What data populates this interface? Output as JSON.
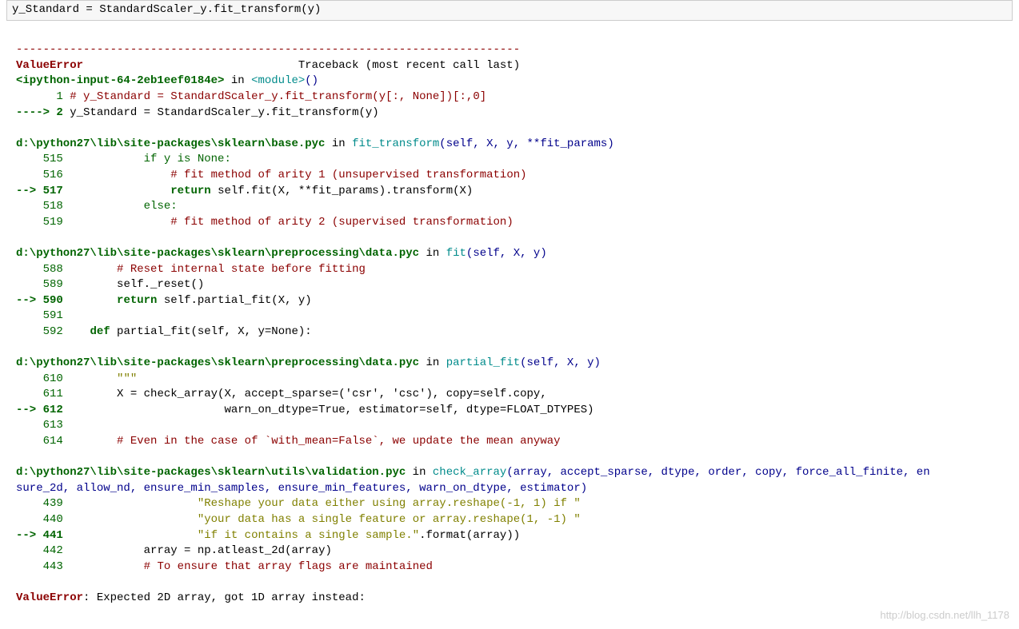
{
  "input_cell": "y_Standard = StandardScaler_y.fit_transform(y)",
  "dashes": "---------------------------------------------------------------------------",
  "header": {
    "error_name": "ValueError",
    "traceback_label": "Traceback (most recent call last)"
  },
  "frame_input": {
    "location": "<ipython-input-64-2eb1eef0184e>",
    "in": " in ",
    "module": "<module>",
    "parens": "()",
    "line1": {
      "num": "1",
      "text": "# y_Standard = StandardScaler_y.fit_transform(y[:, None])[:,0]"
    },
    "line2": {
      "arrow": "----> ",
      "num": "2",
      "text": " y_Standard = StandardScaler_y.fit_transform(y)"
    }
  },
  "frame_base": {
    "path": "d:\\python27\\lib\\site-packages\\sklearn\\base.pyc",
    "in": " in ",
    "func": "fit_transform",
    "sig": "(self, X, y, **fit_params)",
    "l515": {
      "num": "515",
      "code": "            if y is None:"
    },
    "l516": {
      "num": "516",
      "code": "                # fit method of arity 1 (unsupervised transformation)"
    },
    "l517": {
      "arrow": "--> ",
      "num": "517",
      "code_pre": "                ",
      "kw": "return",
      "code_post": " self.fit(X, **fit_params).transform(X)"
    },
    "l518": {
      "num": "518",
      "code": "            else:"
    },
    "l519": {
      "num": "519",
      "code": "                # fit method of arity 2 (supervised transformation)"
    }
  },
  "frame_data_fit": {
    "path": "d:\\python27\\lib\\site-packages\\sklearn\\preprocessing\\data.pyc",
    "in": " in ",
    "func": "fit",
    "sig": "(self, X, y)",
    "l588": {
      "num": "588",
      "code": "        # Reset internal state before fitting"
    },
    "l589": {
      "num": "589",
      "code": "        self._reset()"
    },
    "l590": {
      "arrow": "--> ",
      "num": "590",
      "code_pre": "        ",
      "kw": "return",
      "code_post": " self.partial_fit(X, y)"
    },
    "l591": {
      "num": "591",
      "code": ""
    },
    "l592": {
      "num": "592",
      "code_pre": "    ",
      "kw": "def",
      "code_post": " partial_fit(self, X, y=None):"
    }
  },
  "frame_data_pfit": {
    "path": "d:\\python27\\lib\\site-packages\\sklearn\\preprocessing\\data.pyc",
    "in": " in ",
    "func": "partial_fit",
    "sig": "(self, X, y)",
    "l610": {
      "num": "610",
      "code": "        \"\"\""
    },
    "l611": {
      "num": "611",
      "code": "        X = check_array(X, accept_sparse=('csr', 'csc'), copy=self.copy,"
    },
    "l612": {
      "arrow": "--> ",
      "num": "612",
      "code": "                        warn_on_dtype=True, estimator=self, dtype=FLOAT_DTYPES)"
    },
    "l613": {
      "num": "613",
      "code": ""
    },
    "l614": {
      "num": "614",
      "code": "        # Even in the case of `with_mean=False`, we update the mean anyway"
    }
  },
  "frame_validation": {
    "path": "d:\\python27\\lib\\site-packages\\sklearn\\utils\\validation.pyc",
    "in": " in ",
    "func": "check_array",
    "sig": "(array, accept_sparse, dtype, order, copy, force_all_finite, en",
    "sig2": "sure_2d, allow_nd, ensure_min_samples, ensure_min_features, warn_on_dtype, estimator)",
    "l439": {
      "num": "439",
      "code": "                    \"Reshape your data either using array.reshape(-1, 1) if \""
    },
    "l440": {
      "num": "440",
      "code": "                    \"your data has a single feature or array.reshape(1, -1) \""
    },
    "l441": {
      "arrow": "--> ",
      "num": "441",
      "code": "                    \"if it contains a single sample.\".format(array))"
    },
    "l442": {
      "num": "442",
      "code": "            array = np.atleast_2d(array)"
    },
    "l443": {
      "num": "443",
      "code": "            # To ensure that array flags are maintained"
    }
  },
  "final_error": {
    "name": "ValueError",
    "msg": ": Expected 2D array, got 1D array instead:"
  },
  "watermark": "http://blog.csdn.net/llh_1178"
}
